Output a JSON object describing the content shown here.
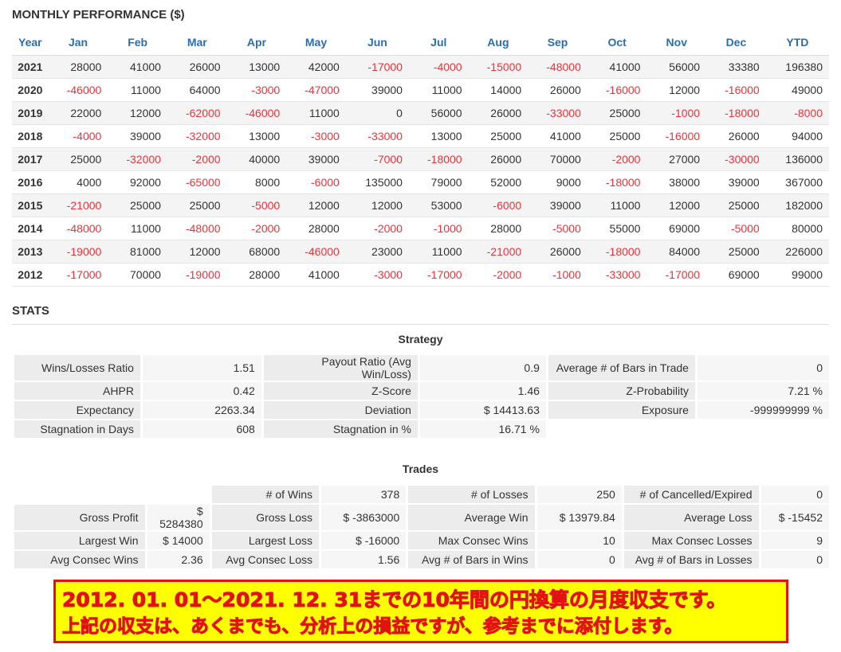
{
  "monthly": {
    "title": "MONTHLY PERFORMANCE ($)",
    "headers": [
      "Year",
      "Jan",
      "Feb",
      "Mar",
      "Apr",
      "May",
      "Jun",
      "Jul",
      "Aug",
      "Sep",
      "Oct",
      "Nov",
      "Dec",
      "YTD"
    ],
    "rows": [
      [
        "2021",
        "28000",
        "41000",
        "26000",
        "13000",
        "42000",
        "-17000",
        "-4000",
        "-15000",
        "-48000",
        "41000",
        "56000",
        "33380",
        "196380"
      ],
      [
        "2020",
        "-46000",
        "11000",
        "64000",
        "-3000",
        "-47000",
        "39000",
        "11000",
        "14000",
        "26000",
        "-16000",
        "12000",
        "-16000",
        "49000"
      ],
      [
        "2019",
        "22000",
        "12000",
        "-62000",
        "-46000",
        "11000",
        "0",
        "56000",
        "26000",
        "-33000",
        "25000",
        "-1000",
        "-18000",
        "-8000"
      ],
      [
        "2018",
        "-4000",
        "39000",
        "-32000",
        "13000",
        "-3000",
        "-33000",
        "13000",
        "25000",
        "41000",
        "25000",
        "-16000",
        "26000",
        "94000"
      ],
      [
        "2017",
        "25000",
        "-32000",
        "-2000",
        "40000",
        "39000",
        "-7000",
        "-18000",
        "26000",
        "70000",
        "-2000",
        "27000",
        "-30000",
        "136000"
      ],
      [
        "2016",
        "4000",
        "92000",
        "-65000",
        "8000",
        "-6000",
        "135000",
        "79000",
        "52000",
        "9000",
        "-18000",
        "38000",
        "39000",
        "367000"
      ],
      [
        "2015",
        "-21000",
        "25000",
        "25000",
        "-5000",
        "12000",
        "12000",
        "53000",
        "-6000",
        "39000",
        "11000",
        "12000",
        "25000",
        "182000"
      ],
      [
        "2014",
        "-48000",
        "11000",
        "-48000",
        "-2000",
        "28000",
        "-2000",
        "-1000",
        "28000",
        "-5000",
        "55000",
        "69000",
        "-5000",
        "80000"
      ],
      [
        "2013",
        "-19000",
        "81000",
        "12000",
        "68000",
        "-46000",
        "23000",
        "11000",
        "-21000",
        "26000",
        "-18000",
        "84000",
        "25000",
        "226000"
      ],
      [
        "2012",
        "-17000",
        "70000",
        "-19000",
        "28000",
        "41000",
        "-3000",
        "-17000",
        "-2000",
        "-1000",
        "-33000",
        "-17000",
        "69000",
        "99000"
      ]
    ]
  },
  "stats": {
    "title": "STATS",
    "strategy_title": "Strategy",
    "strategy_rows": [
      [
        "Wins/Losses Ratio",
        "1.51",
        "Payout Ratio (Avg Win/Loss)",
        "0.9",
        "Average # of Bars in Trade",
        "0"
      ],
      [
        "AHPR",
        "0.42",
        "Z-Score",
        "1.46",
        "Z-Probability",
        "7.21 %"
      ],
      [
        "Expectancy",
        "2263.34",
        "Deviation",
        "$ 14413.63",
        "Exposure",
        "-999999999 %"
      ],
      [
        "Stagnation in Days",
        "608",
        "Stagnation in %",
        "16.71 %",
        "",
        ""
      ]
    ],
    "trades_title": "Trades",
    "trades_rows": [
      [
        "",
        "",
        "# of Wins",
        "378",
        "# of Losses",
        "250",
        "# of Cancelled/Expired",
        "0"
      ],
      [
        "Gross Profit",
        "$ 5284380",
        "Gross Loss",
        "$ -3863000",
        "Average Win",
        "$ 13979.84",
        "Average Loss",
        "$ -15452"
      ],
      [
        "Largest Win",
        "$ 14000",
        "Largest Loss",
        "$ -16000",
        "Max Consec Wins",
        "10",
        "Max Consec Losses",
        "9"
      ],
      [
        "Avg Consec Wins",
        "2.36",
        "Avg Consec Loss",
        "1.56",
        "Avg # of Bars in Wins",
        "0",
        "Avg # of Bars in Losses",
        "0"
      ]
    ]
  },
  "banner": {
    "line1": "2012. 01. 01～2021. 12. 31までの10年間の円換算の月度収支です。",
    "line2": "上記の収支は、あくまでも、分析上の損益ですが、参考までに添付します。",
    "bg_color": "#ffff00",
    "text_color": "#e21212"
  }
}
